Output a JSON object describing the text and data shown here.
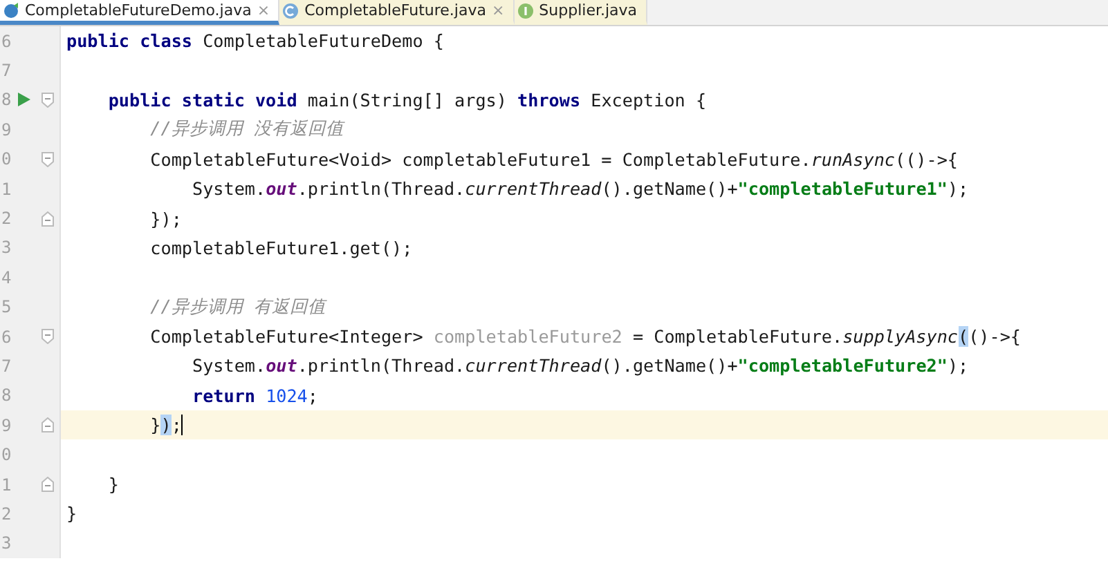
{
  "tabs": [
    {
      "label": "CompletableFutureDemo.java",
      "kind": "class-file",
      "selected": true,
      "close": "×"
    },
    {
      "label": "CompletableFuture.java",
      "kind": "class",
      "selected": false,
      "close": "×"
    },
    {
      "label": "Supplier.java",
      "kind": "interface",
      "selected": false
    }
  ],
  "lines": [
    {
      "number": "6",
      "kind": "plain",
      "current": false,
      "tokens": [
        {
          "kind": "keyword",
          "text": "public class "
        },
        {
          "kind": "plain",
          "text": "CompletableFutureDemo {"
        }
      ]
    },
    {
      "number": "7",
      "kind": "plain",
      "current": false
    },
    {
      "number": "8",
      "kind": "run",
      "current": false,
      "tokens": [
        {
          "kind": "keyword",
          "text": "    public static void "
        },
        {
          "kind": "plain",
          "text": "main(String[] args) "
        },
        {
          "kind": "keyword",
          "text": "throws "
        },
        {
          "kind": "plain",
          "text": "Exception {"
        }
      ]
    },
    {
      "number": "9",
      "kind": "plain",
      "current": false,
      "tokens": [
        {
          "kind": "comment",
          "text": "        //异步调用 没有返回值"
        }
      ]
    },
    {
      "number": "0",
      "kind": "fold-start",
      "current": false,
      "tokens": [
        {
          "kind": "plain",
          "text": "        CompletableFuture<Void> completableFuture1 = CompletableFuture."
        },
        {
          "kind": "static-method",
          "text": "runAsync"
        },
        {
          "kind": "plain",
          "text": "(()->{"
        }
      ]
    },
    {
      "number": "1",
      "kind": "plain",
      "current": false,
      "tokens": [
        {
          "kind": "plain",
          "text": "            System."
        },
        {
          "kind": "static-field",
          "text": "out"
        },
        {
          "kind": "plain",
          "text": ".println(Thread."
        },
        {
          "kind": "static-method",
          "text": "currentThread"
        },
        {
          "kind": "plain",
          "text": "().getName()+"
        },
        {
          "kind": "string",
          "text": "\"completableFuture1\""
        },
        {
          "kind": "plain",
          "text": ");"
        }
      ]
    },
    {
      "number": "2",
      "kind": "fold-end",
      "current": false,
      "tokens": [
        {
          "kind": "plain",
          "text": "        });"
        }
      ]
    },
    {
      "number": "3",
      "kind": "plain",
      "current": false,
      "tokens": [
        {
          "kind": "plain",
          "text": "        completableFuture1.get();"
        }
      ]
    },
    {
      "number": "4",
      "kind": "plain",
      "current": false
    },
    {
      "number": "5",
      "kind": "plain",
      "current": false,
      "tokens": [
        {
          "kind": "comment",
          "text": "        //异步调用 有返回值"
        }
      ]
    },
    {
      "number": "6",
      "kind": "fold-start",
      "current": false,
      "tokens": [
        {
          "kind": "plain",
          "text": "        CompletableFuture<Integer> "
        },
        {
          "kind": "unused",
          "text": "completableFuture2"
        },
        {
          "kind": "plain",
          "text": " = CompletableFuture."
        },
        {
          "kind": "static-method",
          "text": "supplyAsync"
        },
        {
          "kind": "match",
          "text": "("
        },
        {
          "kind": "plain",
          "text": "()->{"
        }
      ]
    },
    {
      "number": "7",
      "kind": "plain",
      "current": false,
      "tokens": [
        {
          "kind": "plain",
          "text": "            System."
        },
        {
          "kind": "static-field",
          "text": "out"
        },
        {
          "kind": "plain",
          "text": ".println(Thread."
        },
        {
          "kind": "static-method",
          "text": "currentThread"
        },
        {
          "kind": "plain",
          "text": "().getName()+"
        },
        {
          "kind": "string",
          "text": "\"completableFuture2\""
        },
        {
          "kind": "plain",
          "text": ");"
        }
      ]
    },
    {
      "number": "8",
      "kind": "plain",
      "current": false,
      "tokens": [
        {
          "kind": "keyword",
          "text": "            return "
        },
        {
          "kind": "number",
          "text": "1024"
        },
        {
          "kind": "plain",
          "text": ";"
        }
      ]
    },
    {
      "number": "9",
      "kind": "fold-end",
      "current": true,
      "tokens": [
        {
          "kind": "plain",
          "text": "        }"
        },
        {
          "kind": "match",
          "text": ")"
        },
        {
          "kind": "plain",
          "text": ";"
        }
      ]
    },
    {
      "number": "0",
      "kind": "plain",
      "current": false
    },
    {
      "number": "1",
      "kind": "fold-end",
      "current": false,
      "tokens": [
        {
          "kind": "plain",
          "text": "    }"
        }
      ]
    },
    {
      "number": "2",
      "kind": "plain",
      "current": false,
      "tokens": [
        {
          "kind": "plain",
          "text": "}"
        }
      ]
    },
    {
      "number": "3",
      "kind": "plain",
      "current": false
    }
  ]
}
